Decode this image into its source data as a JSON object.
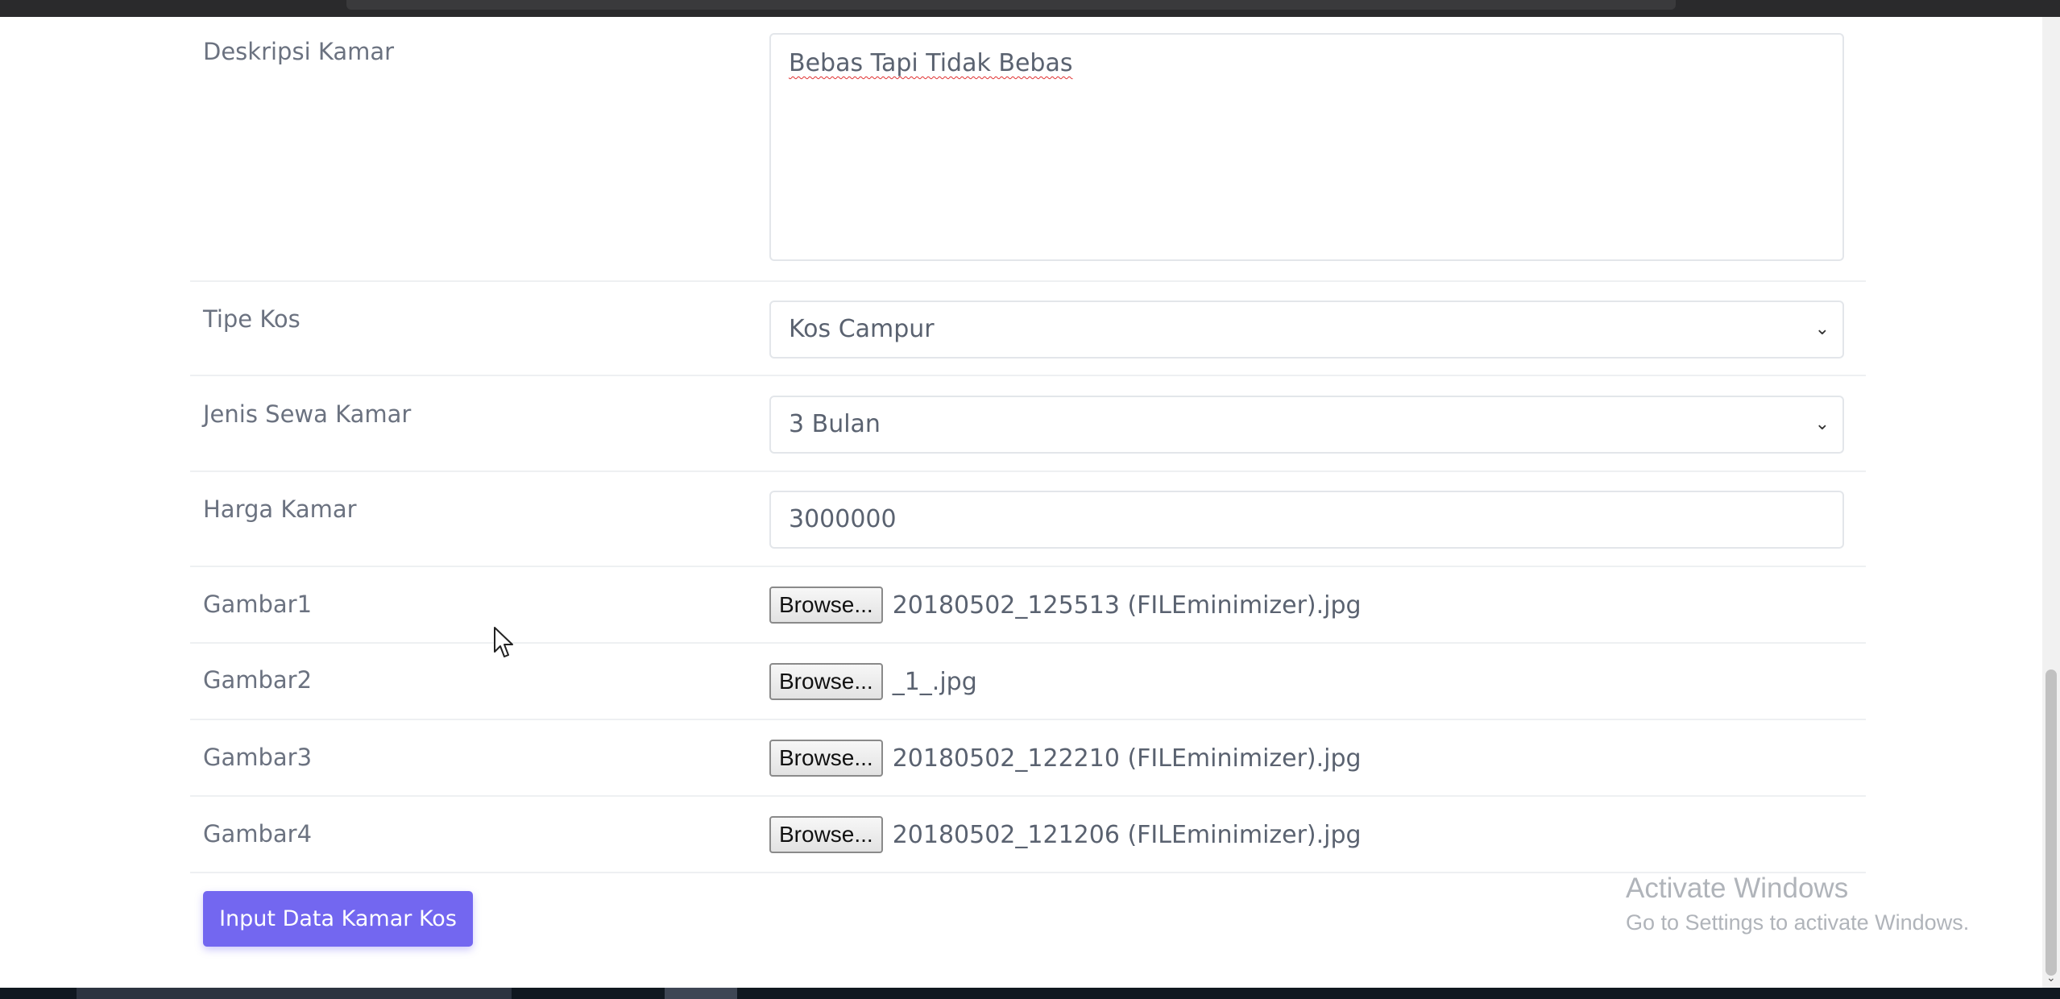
{
  "form": {
    "deskripsi": {
      "label": "Deskripsi Kamar",
      "value": "Bebas Tapi Tidak Bebas"
    },
    "tipe_kos": {
      "label": "Tipe Kos",
      "value": "Kos Campur"
    },
    "jenis_sewa": {
      "label": "Jenis Sewa Kamar",
      "value": "3 Bulan"
    },
    "harga": {
      "label": "Harga Kamar",
      "value": "3000000"
    },
    "files": [
      {
        "label": "Gambar1",
        "button": "Browse...",
        "filename": "20180502_125513 (FILEminimizer).jpg"
      },
      {
        "label": "Gambar2",
        "button": "Browse...",
        "filename": "_1_.jpg"
      },
      {
        "label": "Gambar3",
        "button": "Browse...",
        "filename": "20180502_122210 (FILEminimizer).jpg"
      },
      {
        "label": "Gambar4",
        "button": "Browse...",
        "filename": "20180502_121206 (FILEminimizer).jpg"
      }
    ],
    "submit_label": "Input Data Kamar Kos"
  },
  "watermark": {
    "title": "Activate Windows",
    "subtitle": "Go to Settings to activate Windows."
  },
  "colors": {
    "accent": "#7367f0",
    "label_text": "#6b7280",
    "border": "#e3e6ea"
  },
  "icons": {
    "select_chevron": "chevron-down-icon",
    "cursor": "mouse-pointer-icon"
  }
}
